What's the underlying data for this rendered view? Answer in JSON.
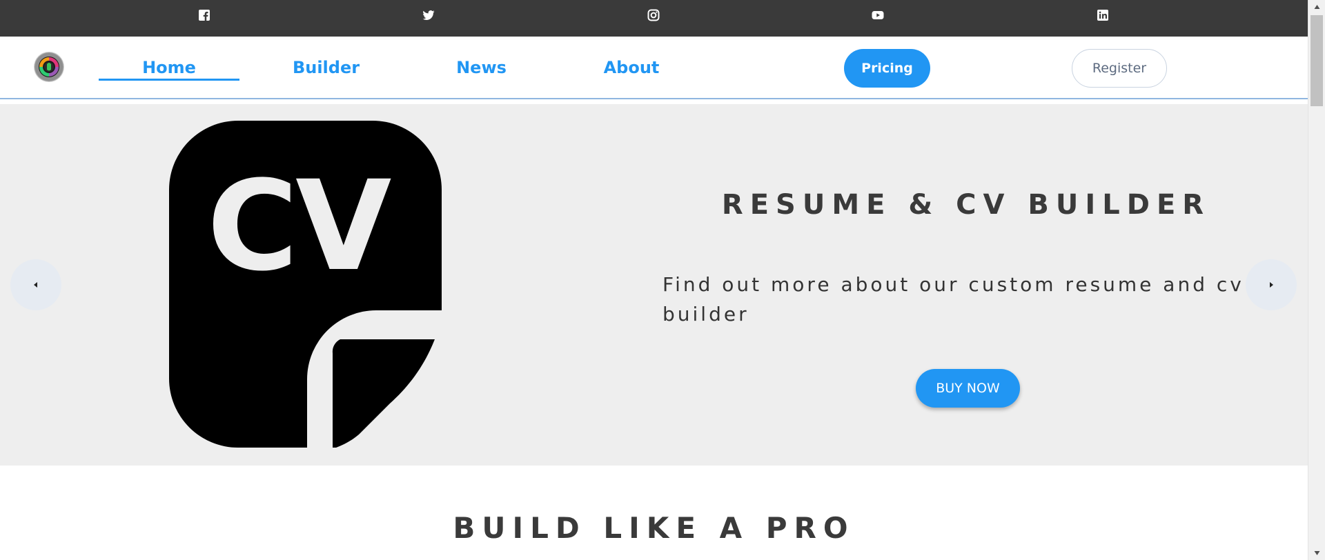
{
  "social": {
    "items": [
      {
        "icon": "facebook-icon"
      },
      {
        "icon": "twitter-icon"
      },
      {
        "icon": "instagram-icon"
      },
      {
        "icon": "youtube-icon"
      },
      {
        "icon": "linkedin-icon"
      }
    ]
  },
  "nav": {
    "home": "Home",
    "builder": "Builder",
    "news": "News",
    "about": "About",
    "pricing": "Pricing",
    "register": "Register",
    "active": "Home"
  },
  "hero": {
    "graphic_text": "CV",
    "title": "RESUME & CV BUILDER",
    "text": "Find out more about our custom resume and cv builder",
    "button": "BUY NOW"
  },
  "section": {
    "title": "BUILD LIKE A PRO"
  },
  "colors": {
    "accent": "#2196f3",
    "social_bar": "#3a3a3a",
    "hero_bg": "#eeeeee",
    "heading": "#3a3a3a"
  }
}
